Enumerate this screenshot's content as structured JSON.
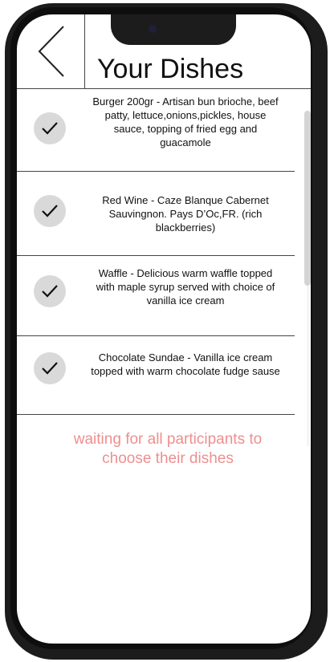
{
  "header": {
    "title": "Your Dishes",
    "back_icon": "chevron-left-icon"
  },
  "dishes": [
    {
      "description": "Burger 200gr - Artisan bun brioche, beef patty, lettuce,onions,pickles, house sauce, topping of fried egg and guacamole",
      "status_icon": "check-icon"
    },
    {
      "description": "Red Wine - Caze Blanque Cabernet Sauvingnon. Pays D’Oc,FR. (rich blackberries)",
      "status_icon": "check-icon"
    },
    {
      "description": "Waffle - Delicious warm waffle topped with maple syrup served with choice of vanilla ice cream",
      "status_icon": "check-icon"
    },
    {
      "description": "Chocolate Sundae - Vanilla ice cream topped with warm chocolate fudge sause",
      "status_icon": "check-icon"
    }
  ],
  "status": {
    "message": "waiting for all participants to choose their dishes"
  },
  "colors": {
    "waiting_text": "#ee8f8f",
    "check_bg": "#d9d9d9",
    "frame": "#1c1c1c"
  }
}
